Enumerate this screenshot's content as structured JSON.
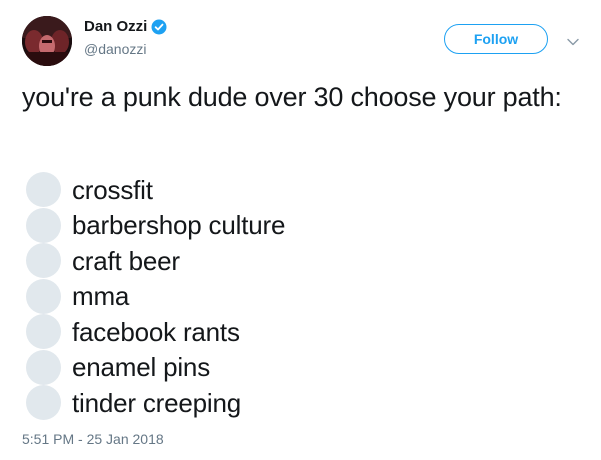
{
  "user": {
    "display_name": "Dan Ozzi",
    "handle": "@danozzi",
    "verified_icon": "verified-badge-icon",
    "avatar_icon": "profile-photo"
  },
  "header": {
    "follow_label": "Follow",
    "menu_icon": "chevron-down-icon"
  },
  "tweet": {
    "text": "you're a punk dude over 30 choose your path:",
    "timestamp": "5:51 PM - 25 Jan 2018"
  },
  "options": [
    "crossfit",
    "barbershop culture",
    "craft beer",
    "mma",
    "facebook rants",
    "enamel pins",
    "tinder creeping"
  ],
  "colors": {
    "accent": "#1da1f2",
    "text": "#14171a",
    "secondary": "#657786",
    "radio": "#e1e8ed"
  }
}
